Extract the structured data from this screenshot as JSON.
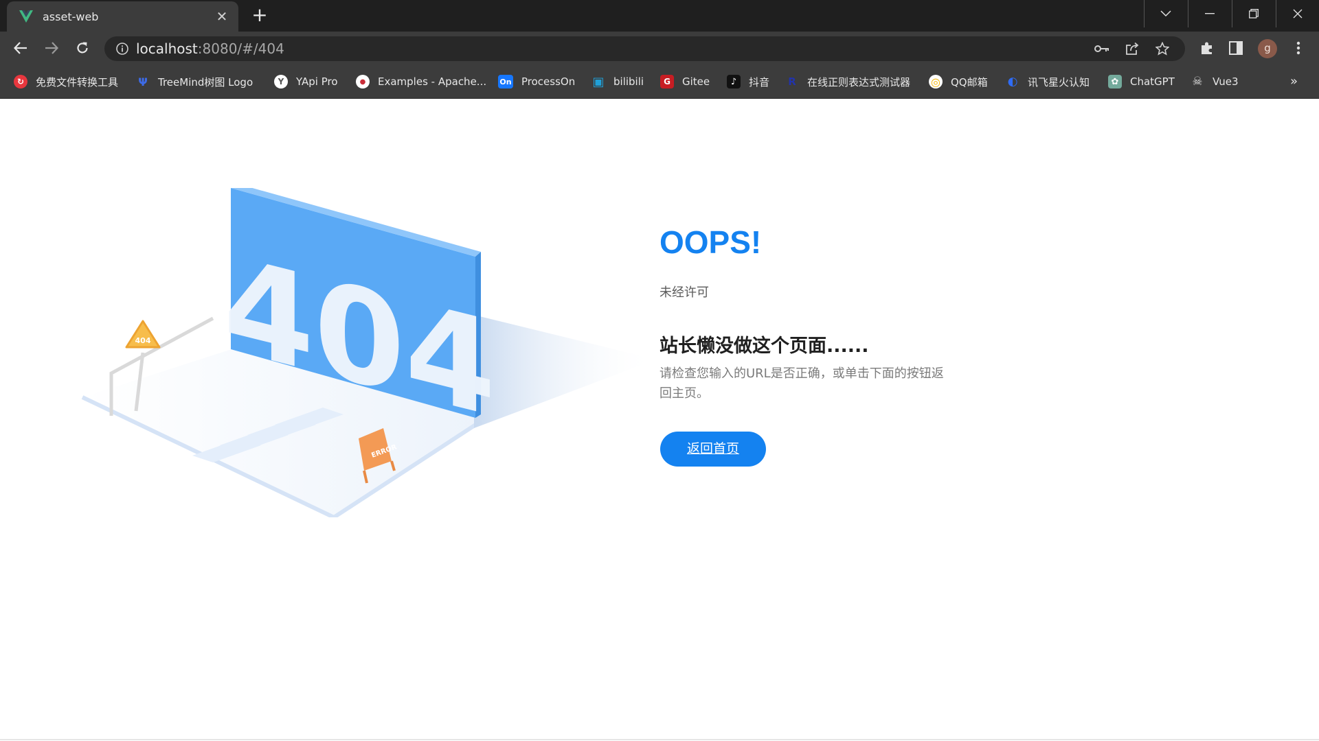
{
  "tab": {
    "title": "asset-web",
    "close_glyph": "✕",
    "favicon": "vue-icon"
  },
  "new_tab_glyph": "+",
  "toolbar": {
    "url_host": "localhost",
    "url_rest": ":8080/#/404",
    "icons": [
      "back-icon",
      "forward-icon",
      "reload-icon",
      "info-icon",
      "key-icon",
      "share-icon",
      "star-icon",
      "extensions-icon",
      "side-panel-icon",
      "menu-icon"
    ],
    "profile_initial": "g"
  },
  "bookmarks": {
    "items": [
      {
        "label": "免费文件转换工具",
        "icon": "convert-icon",
        "color": "#e8373e",
        "glyph": "↻"
      },
      {
        "label": "TreeMind树图 Logo",
        "icon": "treemind-icon",
        "color": "#3d6be8",
        "glyph": "Ψ"
      },
      {
        "label": "YApi Pro",
        "icon": "yapi-icon",
        "color": "#ffffff",
        "glyph": "Y"
      },
      {
        "label": "Examples - Apache...",
        "icon": "apache-icon",
        "color": "#c92d39",
        "glyph": "●"
      },
      {
        "label": "ProcessOn",
        "icon": "processon-icon",
        "color": "#1677ff",
        "glyph": "On"
      },
      {
        "label": "bilibili",
        "icon": "bilibili-icon",
        "color": "#20a0d8",
        "glyph": "▣"
      },
      {
        "label": "Gitee",
        "icon": "gitee-icon",
        "color": "#c71d23",
        "glyph": "G"
      },
      {
        "label": "抖音",
        "icon": "douyin-icon",
        "color": "#111111",
        "glyph": "♪"
      },
      {
        "label": "在线正则表达式测试器",
        "icon": "regex-icon",
        "color": "#1a237e",
        "glyph": "R"
      },
      {
        "label": "QQ邮箱",
        "icon": "qqmail-icon",
        "color": "#f4b400",
        "glyph": "◎"
      },
      {
        "label": "讯飞星火认知",
        "icon": "xunfei-icon",
        "color": "#2f6cf6",
        "glyph": "◐"
      },
      {
        "label": "ChatGPT",
        "icon": "chatgpt-icon",
        "color": "#74aa9c",
        "glyph": "✿"
      },
      {
        "label": "Vue3",
        "icon": "vue3-icon",
        "color": "#555555",
        "glyph": "☠"
      }
    ],
    "more": "»"
  },
  "page": {
    "oops": "OOPS!",
    "subtitle": "未经许可",
    "headline": "站长懒没做这个页面......",
    "description": "请检查您输入的URL是否正确，或单击下面的按钮返回主页。",
    "button_label": "返回首页",
    "illustration": {
      "big_text": "404",
      "sign_text": "404",
      "barrier_text": "ERROR"
    }
  }
}
